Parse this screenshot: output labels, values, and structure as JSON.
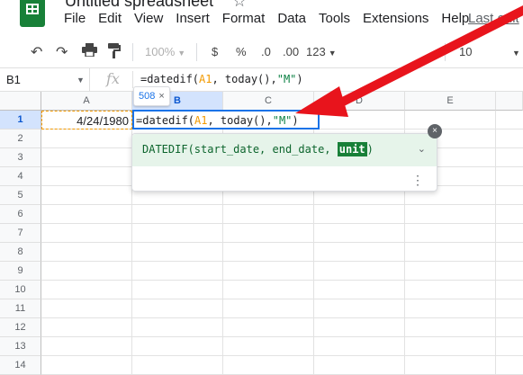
{
  "app": {
    "title": "Untitled spreadsheet",
    "last_edit": "Last edit"
  },
  "menu": [
    "File",
    "Edit",
    "View",
    "Insert",
    "Format",
    "Data",
    "Tools",
    "Extensions",
    "Help"
  ],
  "toolbar": {
    "zoom": "100%",
    "currency": "$",
    "percent": "%",
    "decimal_decrease": ".0",
    "decimal_increase": ".00",
    "number_format": "123",
    "font_size": "10"
  },
  "formula_bar": {
    "name_box": "B1",
    "fx_label": "fx",
    "prefix": "=datedif(",
    "ref": "A1",
    "middle": ", today(),",
    "string": "\"M\"",
    "suffix": ")"
  },
  "columns": [
    "A",
    "B",
    "C",
    "D",
    "E"
  ],
  "rows": [
    "1",
    "2",
    "3",
    "4",
    "5",
    "6",
    "7",
    "8",
    "9",
    "10",
    "11",
    "12",
    "13",
    "14"
  ],
  "cells": {
    "A1": "4/24/1980",
    "B1_prefix": "=datedif(",
    "B1_ref": "A1",
    "B1_middle": ", today(),",
    "B1_string": "\"M\"",
    "B1_suffix": ")"
  },
  "chip": {
    "value": "508",
    "close": "×"
  },
  "helper": {
    "sig_prefix": "DATEDIF(start_date, end_date, ",
    "sig_highlight": "unit",
    "sig_suffix": ")",
    "chevron": "⌄",
    "more": "⋮",
    "close": "×"
  },
  "colors": {
    "accent": "#1a73e8",
    "annotation_arrow": "#e8141c",
    "ref_orange": "#f29900",
    "string_green": "#0b8043"
  },
  "icons": [
    "sheets-logo-icon",
    "star-icon",
    "undo-icon",
    "redo-icon",
    "print-icon",
    "paint-format-icon"
  ]
}
